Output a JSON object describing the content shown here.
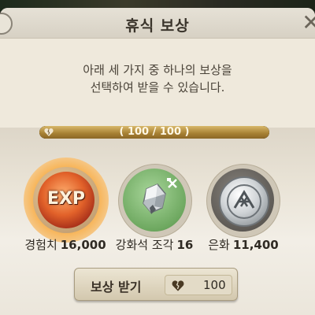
{
  "dialog": {
    "title": "휴식 보상",
    "description_lines": [
      "아래 세 가지 중 하나의 보상을",
      "선택하여 받을 수 있습니다."
    ]
  },
  "rest_gauge": {
    "text": "( 100 / 100 )",
    "current": 100,
    "max": 100,
    "icon": "broken-heart-icon"
  },
  "rewards": [
    {
      "icon": "exp-orb-icon",
      "icon_text": "EXP",
      "name": "경험치",
      "amount": "16,000",
      "highlighted": true
    },
    {
      "icon": "enhancement-stone-icon",
      "name": "강화석 조각",
      "amount": "16",
      "highlighted": false
    },
    {
      "icon": "silver-coin-icon",
      "name": "은화",
      "amount": "11,400",
      "highlighted": false
    }
  ],
  "claim_button": {
    "label": "보상 받기",
    "cost_icon": "heart-icon",
    "cost": "100"
  },
  "colors": {
    "gauge_fill": "#b08a3e",
    "panel_bg": "#efe9dc",
    "highlight_glow": "#f2a64a"
  }
}
